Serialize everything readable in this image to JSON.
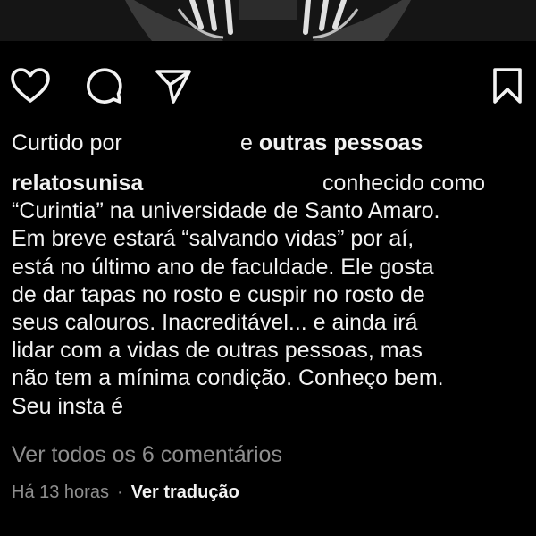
{
  "post": {
    "image_alt": "post image"
  },
  "actions": {
    "like_icon": "heart-outline-icon",
    "comment_icon": "comment-bubble-icon",
    "share_icon": "paper-plane-icon",
    "save_icon": "bookmark-outline-icon"
  },
  "likes": {
    "prefix": "Curtido por",
    "connector": "e",
    "others": "outras pessoas"
  },
  "caption": {
    "username": "relatosunisa",
    "line1_tail": "conhecido como",
    "lines": [
      "“Curintia” na universidade de Santo Amaro.",
      "Em breve estará “salvando vidas” por aí,",
      "está no último ano de faculdade. Ele gosta",
      "de dar tapas no rosto e cuspir no rosto de",
      "seus calouros. Inacreditável... e ainda irá",
      "lidar com a vidas de outras pessoas, mas",
      "não tem a mínima condição. Conheço bem.",
      "Seu insta é"
    ]
  },
  "comments": {
    "view_all": "Ver todos os 6 comentários"
  },
  "meta": {
    "time_ago": "Há 13 horas",
    "separator": "·",
    "translate": "Ver tradução"
  },
  "colors": {
    "background": "#000000",
    "text": "#f2f2f2",
    "muted": "#8e8e8e"
  }
}
